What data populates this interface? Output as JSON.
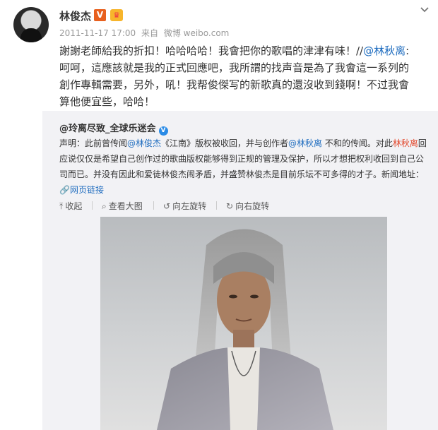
{
  "post": {
    "author": "林俊杰",
    "verified_badge": "V",
    "member_badge": "♛",
    "timestamp": "2011-11-17 17:00",
    "source_prefix": "来自",
    "source": "微博 weibo.com",
    "text_part1": "謝謝老師給我的折扣！哈哈哈哈！我會把你的歌唱的津津有味！//",
    "mention": "@林秋离",
    "text_part2": ": 呵呵，這應該就是我的正式回應吧，我所謂的找声音是為了我會這一系列的創作專輯需要，另外，吼！我帮俊傑写的新歌真的還沒收到錢啊！不过我會算他便宜些，哈哈！"
  },
  "repost": {
    "author": "@玲离尽致_全球乐迷会",
    "t1": "声明：此前曾传闻",
    "m1": "@林俊杰",
    "t2": "《江南》版权被收回，并与创作者",
    "m2": "@林秋离",
    "t3": " 不和的传闻。对此",
    "r1": "林秋离",
    "t4": "回应说仅仅是希望自己创作过的歌曲版权能够得到正规的管理及保护，所以才想把权利收回到自己公司而已。并没有因此和爱徒林俊杰闹矛盾，并盛赞林俊杰是目前乐坛不可多得的才子。新闻地址：",
    "link_label": "网页链接"
  },
  "actions": {
    "collapse": "收起",
    "view_large": "查看大图",
    "rotate_left": "向左旋转",
    "rotate_right": "向右旋转"
  },
  "icons": {
    "chevron": "chevron-down-icon",
    "collapse": "arrow-up-icon",
    "zoom": "magnifier-icon",
    "rotate_left": "rotate-left-icon",
    "rotate_right": "rotate-right-icon",
    "link": "link-icon"
  },
  "colors": {
    "mention_orange": "#eb7350",
    "link_blue": "#1e6cbf",
    "highlight_red": "#e2462a",
    "repost_bg": "#f2f2f5"
  }
}
